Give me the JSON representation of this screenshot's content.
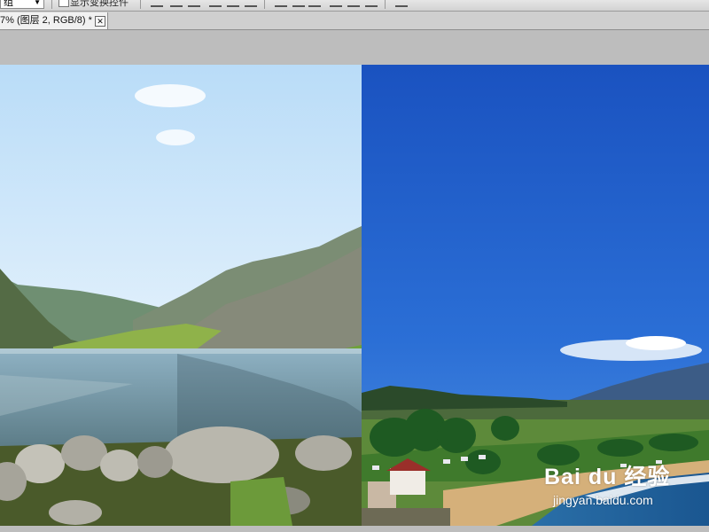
{
  "toolbar": {
    "select_value": "组",
    "checkbox_label": "显示变换控件"
  },
  "document_tab": {
    "title": "7% (图层 2, RGB/8) *",
    "close_glyph": "✕"
  },
  "canvas": {
    "left_image": "mountain-lake-photo",
    "right_image": "tropical-coast-photo"
  },
  "watermark": {
    "brand": "Bai du 经验",
    "url": "jingyan.baidu.com"
  },
  "colors": {
    "workspace": "#bdbdbd",
    "tab_active": "#f1f1f1",
    "sky_left": "#d8ecfb",
    "sky_right": "#1f5fc9"
  }
}
